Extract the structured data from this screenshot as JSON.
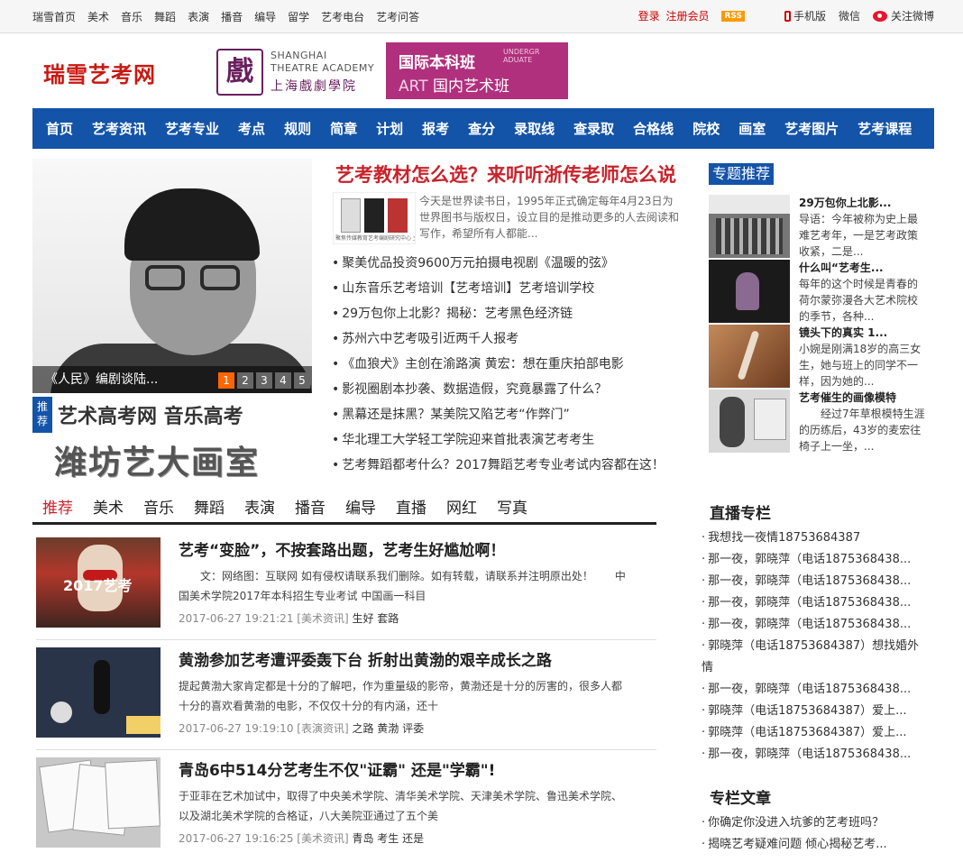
{
  "topbar": {
    "nav": [
      "瑞雪首页",
      "美术",
      "音乐",
      "舞蹈",
      "表演",
      "播音",
      "编导",
      "留学",
      "艺考电台",
      "艺考问答"
    ],
    "login": "登录",
    "register": "注册会员",
    "rss": "RSS",
    "mobile": "手机版",
    "wechat": "微信",
    "weibo": "关注微博"
  },
  "header": {
    "logo": "瑞雪艺考网",
    "ad_sta": {
      "en1": "SHANGHAI",
      "en2": "THEATRE ACADEMY",
      "cn": "上海戲劇學院",
      "mark": "戲"
    },
    "ad_art": {
      "line1": "国际本科班",
      "en": "UNDERGR ADUATE",
      "art": "ART",
      "line2": "国内艺术班"
    }
  },
  "mainnav": [
    "首页",
    "艺考资讯",
    "艺考专业",
    "考点",
    "规则",
    "简章",
    "计划",
    "报考",
    "查分",
    "录取线",
    "查录取",
    "合格线",
    "院校",
    "画室",
    "艺考图片",
    "艺考课程"
  ],
  "slider": {
    "caption": "《人民》编剧谈陆...",
    "pages": [
      "1",
      "2",
      "3",
      "4",
      "5"
    ],
    "active": 1
  },
  "recommend": {
    "tag": "推荐",
    "line1": "艺术高考网 音乐高考",
    "line2": "潍坊艺大画室"
  },
  "headline": {
    "title": "艺考教材怎么选？来听听浙传老师怎么说",
    "summary": "今天是世界读书日，1995年正式确定每年4月23日为世界图书与版权日，设立目的是推动更多的人去阅读和写作，希望所有人都能...",
    "thumb_caption": "聚焦传媒教育艺考编剧研究中心 主编"
  },
  "news": [
    "聚美优品投资9600万元拍摄电视剧《温暖的弦》",
    "山东音乐艺考培训【艺考培训】艺考培训学校",
    "29万包你上北影？揭秘：艺考黑色经济链",
    "苏州六中艺考吸引近两千人报考",
    "《血狼犬》主创在渝路演 黄宏：想在重庆拍部电影",
    "影视圈剧本抄袭、数据造假，究竟暴露了什么？",
    "黑幕还是抹黑？某美院又陷艺考“作弊门”",
    "华北理工大学轻工学院迎来首批表演艺考考生",
    "艺考舞蹈都考什么？2017舞蹈艺考专业考试内容都在这！"
  ],
  "topics": {
    "title": "专题推荐",
    "items": [
      {
        "title": "29万包你上北影...",
        "desc": "导语：今年被称为史上最难艺考年，一是艺考政策收紧，二是..."
      },
      {
        "title": "什么叫“艺考生...",
        "desc": "每年的这个时候是青春的荷尔蒙弥漫各大艺术院校的季节，各种..."
      },
      {
        "title": "镜头下的真实 1...",
        "desc": "小婉是刚满18岁的高三女生，她与班上的同学不一样，因为她的..."
      },
      {
        "title": "艺考催生的画像模特",
        "desc": "　　经过7年草根模特生涯的历练后，43岁的麦宏往椅子上一坐，..."
      }
    ]
  },
  "tabs": [
    "推荐",
    "美术",
    "音乐",
    "舞蹈",
    "表演",
    "播音",
    "编导",
    "直播",
    "网红",
    "写真"
  ],
  "articles": [
    {
      "title": "艺考“变脸”，不按套路出题，艺考生好尴尬啊！",
      "desc": "　　文：网络图：互联网 如有侵权请联系我们删除。如有转载，请联系并注明原出处！　　中国美术学院2017年本科招生专业考试 中国画一科目",
      "date": "2017-06-27 19:21:21",
      "cat": "[美术资讯]",
      "tags": "生好 套路",
      "img_caption": "2017艺考"
    },
    {
      "title": "黄渤参加艺考遭评委轰下台 折射出黄渤的艰辛成长之路",
      "desc": "提起黄渤大家肯定都是十分的了解吧，作为重量级的影帝，黄渤还是十分的厉害的，很多人都十分的喜欢看黄渤的电影，不仅仅十分的有内涵，还十",
      "date": "2017-06-27 19:19:10",
      "cat": "[表演资讯]",
      "tags": "之路 黄渤 评委",
      "img_caption": ""
    },
    {
      "title": "青岛6中514分艺考生不仅\"证霸\" 还是\"学霸\"!",
      "desc": "于亚菲在艺术加试中，取得了中央美术学院、清华美术学院、天津美术学院、鲁迅美术学院、以及湖北美术学院的合格证，八大美院亚通过了五个美",
      "date": "2017-06-27 19:16:25",
      "cat": "[美术资讯]",
      "tags": "青岛 考生 还是",
      "img_caption": ""
    }
  ],
  "live": {
    "title": "直播专栏",
    "items": [
      "我想找一夜情18753684387",
      "那一夜，郭晓萍（电话1875368438...",
      "那一夜，郭晓萍（电话1875368438...",
      "那一夜，郭晓萍（电话1875368438...",
      "那一夜，郭晓萍（电话1875368438...",
      "郭晓萍（电话18753684387）想找婚外情",
      "那一夜，郭晓萍（电话1875368438...",
      "郭晓萍（电话18753684387）爱上...",
      "郭晓萍（电话18753684387）爱上...",
      "那一夜，郭晓萍（电话1875368438..."
    ]
  },
  "column": {
    "title": "专栏文章",
    "items": [
      "你确定你没进入坑爹的艺考班吗？",
      "揭晓艺考疑难问题 倾心揭秘艺考..."
    ]
  }
}
